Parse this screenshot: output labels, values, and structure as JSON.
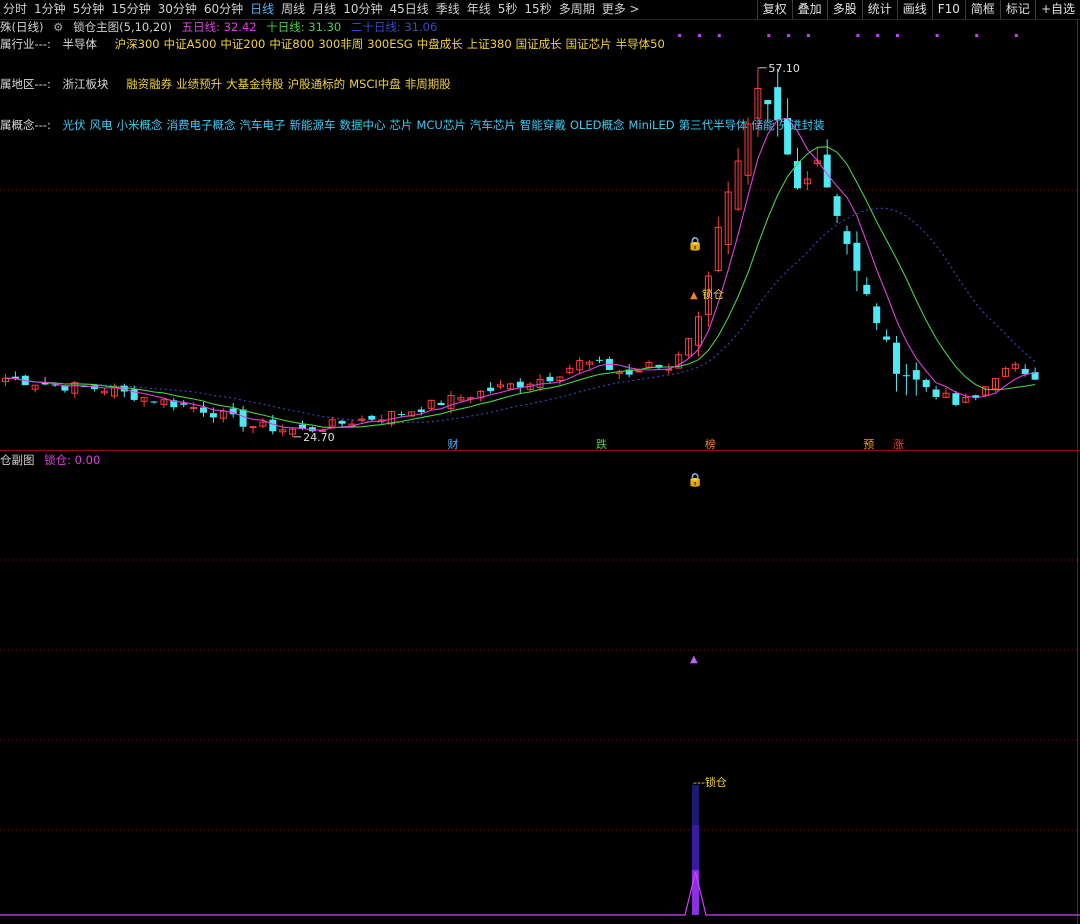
{
  "toolbar": {
    "periods": [
      "分时",
      "1分钟",
      "5分钟",
      "15分钟",
      "30分钟",
      "60分钟",
      "日线",
      "周线",
      "月线",
      "10分钟",
      "45日线",
      "季线",
      "年线",
      "5秒",
      "15秒",
      "多周期",
      "更多 >"
    ],
    "active_period": "日线",
    "tools": [
      "复权",
      "叠加",
      "多股",
      "统计",
      "画线",
      "F10",
      "简框",
      "标记",
      "+自选"
    ]
  },
  "legend": {
    "title": "殊(日线)",
    "indicator": "锁仓主图(5,10,20)",
    "ma5": "五日线: 32.42",
    "ma10": "十日线: 31.30",
    "ma20": "二十日线: 31.06"
  },
  "info": {
    "industry_label": "属行业---:",
    "industry": "半导体",
    "industry_tags": [
      "沪深300",
      "中证A500",
      "中证200",
      "中证800",
      "300非周",
      "300ESG",
      "中盘成长",
      "上证380",
      "国证成长",
      "国证芯片",
      "半导体50"
    ],
    "region_label": "属地区---:",
    "region": "浙江板块",
    "region_tags": [
      "融资融券",
      "业绩预升",
      "大基金持股",
      "沪股通标的",
      "MSCI中盘",
      "非周期股"
    ],
    "concept_label": "属概念---:",
    "concept_tags": [
      "光伏",
      "风电",
      "小米概念",
      "消费电子概念",
      "汽车电子",
      "新能源车",
      "数据中心",
      "芯片",
      "MCU芯片",
      "汽车芯片",
      "智能穿戴",
      "OLED概念",
      "MiniLED",
      "第三代半导体",
      "储能",
      "先进封装"
    ]
  },
  "annotations": {
    "high_label": "57.10",
    "low_label": "24.70",
    "lock_label": "锁仓",
    "sub_lock_label": "---锁仓",
    "markers": [
      "财",
      "跌",
      "榜",
      "预",
      "涨"
    ]
  },
  "sub": {
    "title": "仓副图",
    "value": "锁仓: 0.00"
  },
  "colors": {
    "up": "#ff3c3c",
    "down": "#4fe8f5",
    "ma5": "#e040e0",
    "ma10": "#4ad04a",
    "ma20": "#3b47c8",
    "industry_tag": "#f0d040",
    "concept_tag": "#40c8f0"
  },
  "chart_data": {
    "type": "candlestick",
    "series": [
      {
        "name": "五日线",
        "values": []
      },
      {
        "name": "十日线",
        "values": []
      },
      {
        "name": "二十日线",
        "values": []
      }
    ],
    "close_points": [
      [
        0,
        29.2
      ],
      [
        5,
        28.6
      ],
      [
        10,
        28.3
      ],
      [
        15,
        27.4
      ],
      [
        20,
        26.6
      ],
      [
        25,
        25.2
      ],
      [
        30,
        24.8
      ],
      [
        35,
        25.6
      ],
      [
        40,
        26.3
      ],
      [
        45,
        27.4
      ],
      [
        50,
        28.4
      ],
      [
        55,
        29.3
      ],
      [
        58,
        30.5
      ],
      [
        60,
        30.3
      ],
      [
        63,
        29.5
      ],
      [
        65,
        30.2
      ],
      [
        67,
        30.0
      ],
      [
        70,
        34.1
      ],
      [
        72,
        42.0
      ],
      [
        74,
        47.0
      ],
      [
        76,
        53.0
      ],
      [
        78,
        50.5
      ],
      [
        80,
        45.0
      ],
      [
        82,
        47.5
      ],
      [
        84,
        43.0
      ],
      [
        86,
        38.0
      ],
      [
        88,
        34.0
      ],
      [
        90,
        30.0
      ],
      [
        92,
        29.0
      ],
      [
        94,
        28.0
      ],
      [
        96,
        27.0
      ],
      [
        98,
        27.5
      ],
      [
        100,
        29.5
      ],
      [
        102,
        30.0
      ],
      [
        104,
        29.5
      ]
    ],
    "high": 57.1,
    "low": 24.7,
    "lock_day": 70,
    "sub_lock": {
      "name": "锁仓",
      "value": 0.0
    }
  }
}
